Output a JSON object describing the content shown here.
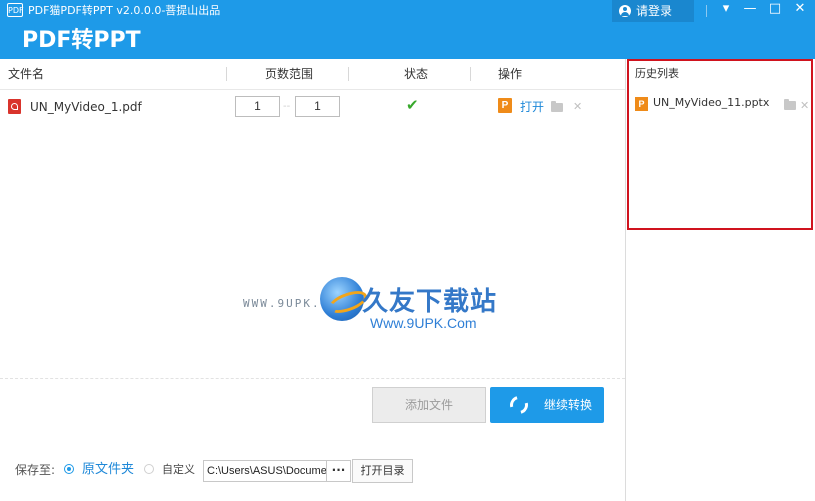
{
  "window": {
    "app_icon_text": "PDF",
    "title": "PDF猫PDF转PPT v2.0.0.0-菩提山出品",
    "brand": "PDF转PPT",
    "login_label": "请登录",
    "controls": {
      "menu": "▾",
      "minimize": "—",
      "maximize": "□",
      "close": "✕"
    }
  },
  "table": {
    "headers": {
      "filename": "文件名",
      "page_range": "页数范围",
      "status": "状态",
      "actions": "操作"
    },
    "rows": [
      {
        "filename": "UN_MyVideo_1.pdf",
        "page_from": "1",
        "page_to": "1",
        "status_icon": "check-icon",
        "open_label": "打开"
      }
    ]
  },
  "watermark": {
    "url_text": "WWW.9UPK.COM",
    "site_name": "久友下载站",
    "site_url": "Www.9UPK.Com"
  },
  "buttons": {
    "add_file": "添加文件",
    "continue_convert": "继续转换"
  },
  "save": {
    "label": "保存至:",
    "option_original": "原文件夹",
    "option_custom": "自定义",
    "path": "C:\\Users\\ASUS\\Documents",
    "browse": "···",
    "open_dir": "打开目录"
  },
  "history": {
    "title": "历史列表",
    "items": [
      {
        "name": "UN_MyVideo_11.pptx"
      }
    ]
  },
  "colors": {
    "accent": "#1e9ae8",
    "pdf": "#d9342c",
    "ppt": "#ef8b19",
    "success": "#38a82c",
    "highlight": "#d0131e"
  }
}
